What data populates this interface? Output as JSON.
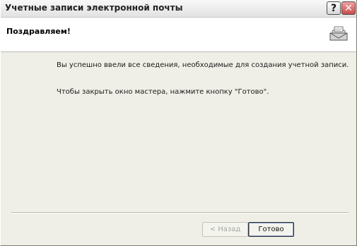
{
  "window": {
    "title": "Учетные записи электронной почты",
    "help_glyph": "?",
    "close_glyph": "✕"
  },
  "header": {
    "title": "Поздравляем!",
    "icon": "mail-printer-icon"
  },
  "body": {
    "line1": "Вы успешно ввели все сведения, необходимые для создания учетной записи.",
    "line2": "Чтобы закрыть окно мастера, нажмите кнопку \"Готово\"."
  },
  "buttons": {
    "back": "< Назад",
    "finish": "Готово"
  }
}
